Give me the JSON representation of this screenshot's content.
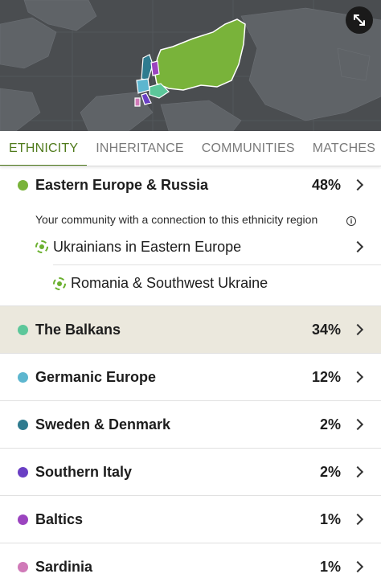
{
  "tabs": [
    {
      "label": "ETHNICITY",
      "active": true
    },
    {
      "label": "INHERITANCE",
      "active": false
    },
    {
      "label": "COMMUNITIES",
      "active": false
    },
    {
      "label": "MATCHES",
      "active": false
    },
    {
      "label": "M",
      "active": false
    }
  ],
  "regions": [
    {
      "name": "Eastern Europe & Russia",
      "percent": "48%",
      "color": "#79b33a"
    },
    {
      "name": "The Balkans",
      "percent": "34%",
      "color": "#5cc79a"
    },
    {
      "name": "Germanic Europe",
      "percent": "12%",
      "color": "#5db6cf"
    },
    {
      "name": "Sweden & Denmark",
      "percent": "2%",
      "color": "#2f7b8f"
    },
    {
      "name": "Southern Italy",
      "percent": "2%",
      "color": "#6a3fc4"
    },
    {
      "name": "Baltics",
      "percent": "1%",
      "color": "#9b44bf"
    },
    {
      "name": "Sardinia",
      "percent": "1%",
      "color": "#d07ab8"
    }
  ],
  "community": {
    "note": "Your community with a connection to this ethnicity region",
    "community_name": "Ukrainians in Eastern Europe",
    "sub_community_name": "Romania & Southwest Ukraine",
    "color": "#6ab02e"
  },
  "map": {
    "highlight_color": "#79b33a",
    "background_color": "#4a4d50",
    "land_color": "#5f6367"
  }
}
